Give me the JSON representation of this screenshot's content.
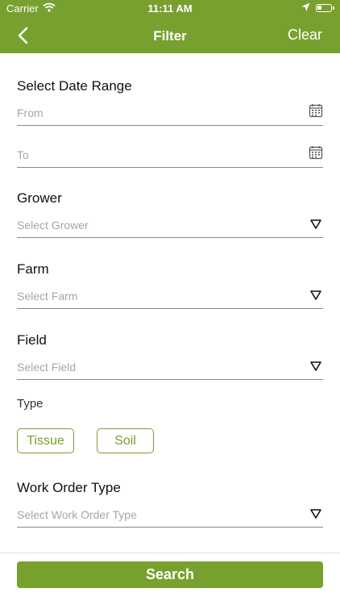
{
  "status_bar": {
    "carrier": "Carrier",
    "time": "11:11 AM"
  },
  "nav": {
    "title": "Filter",
    "clear_label": "Clear"
  },
  "date_range": {
    "label": "Select Date Range",
    "from_placeholder": "From",
    "to_placeholder": "To"
  },
  "grower": {
    "label": "Grower",
    "placeholder": "Select Grower"
  },
  "farm": {
    "label": "Farm",
    "placeholder": "Select Farm"
  },
  "field": {
    "label": "Field",
    "placeholder": "Select Field"
  },
  "type": {
    "label": "Type",
    "options": [
      "Tissue",
      "Soil"
    ]
  },
  "work_order_type": {
    "label": "Work Order Type",
    "placeholder": "Select Work Order Type"
  },
  "search_label": "Search",
  "colors": {
    "accent": "#78a02e",
    "placeholder": "#a6a6a6"
  },
  "icons": {
    "back": "chevron-left-icon",
    "calendar": "calendar-icon",
    "dropdown": "triangle-down-icon",
    "wifi": "wifi-icon",
    "location": "location-arrow-icon",
    "battery": "battery-icon"
  }
}
